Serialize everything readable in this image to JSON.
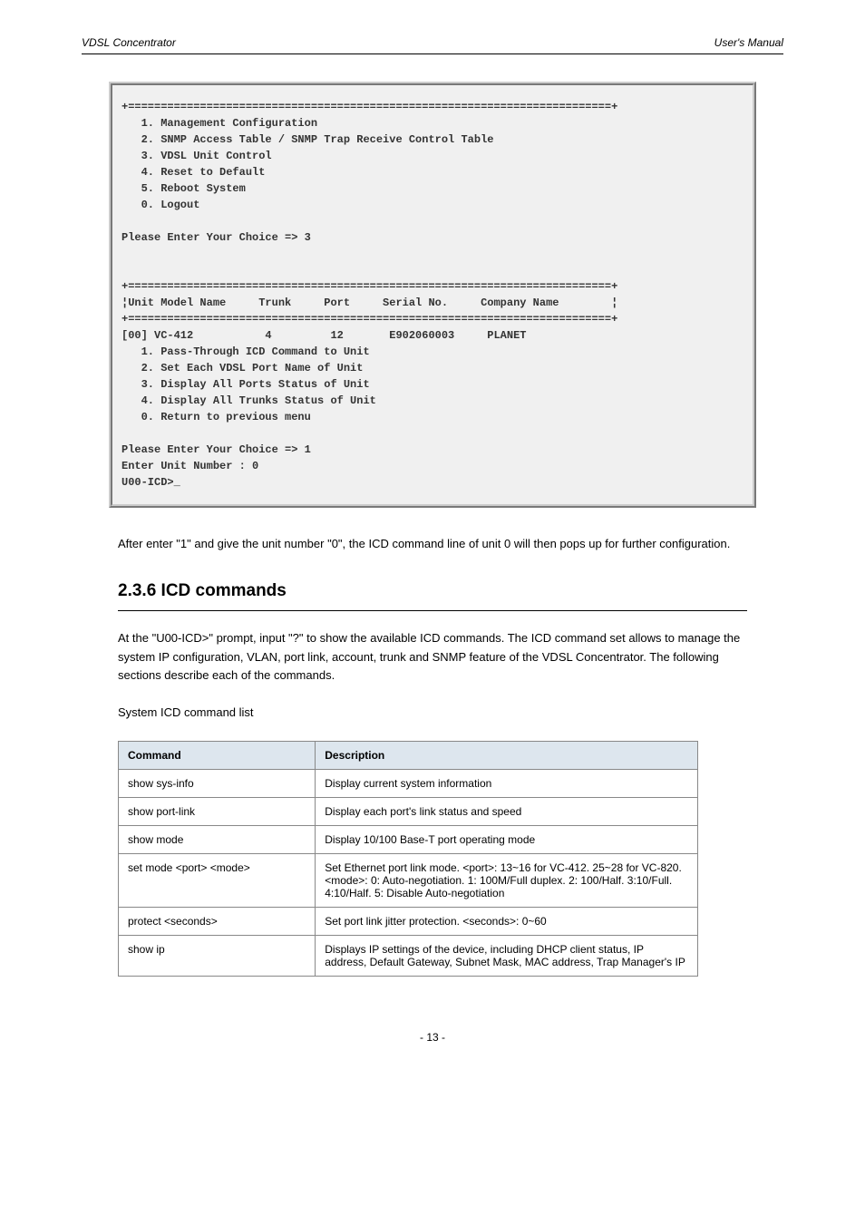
{
  "header": {
    "left": "VDSL Concentrator",
    "right": "User's Manual"
  },
  "terminal": "+==========================================================================+\n   1. Management Configuration\n   2. SNMP Access Table / SNMP Trap Receive Control Table\n   3. VDSL Unit Control\n   4. Reset to Default\n   5. Reboot System\n   0. Logout\n\nPlease Enter Your Choice => 3\n\n\n+==========================================================================+\n¦Unit Model Name     Trunk     Port     Serial No.     Company Name        ¦\n+==========================================================================+\n[00] VC-412           4         12       E902060003     PLANET\n   1. Pass-Through ICD Command to Unit\n   2. Set Each VDSL Port Name of Unit\n   3. Display All Ports Status of Unit\n   4. Display All Trunks Status of Unit\n   0. Return to previous menu\n\nPlease Enter Your Choice => 1\nEnter Unit Number : 0\nU00-ICD>_",
  "paragraphs": {
    "p1": "After enter \"1\" and give the unit number \"0\", the ICD command line of unit 0 will then pops up for further configuration.",
    "heading": "2.3.6 ICD commands",
    "p2": "At the \"U00-ICD>\" prompt, input \"?\" to show the available ICD commands. The ICD command set allows to manage the system IP configuration, VLAN, port link, account, trunk and SNMP feature of the VDSL Concentrator. The following sections describe each of the commands.",
    "listTitle": "System ICD command list"
  },
  "table": {
    "header": {
      "cmd": "Command",
      "desc": "Description"
    },
    "rows": [
      {
        "cmd": "show sys-info",
        "desc": "Display current system information"
      },
      {
        "cmd": "show port-link",
        "desc": "Display each port's link status and speed"
      },
      {
        "cmd": "show mode",
        "desc": "Display 10/100 Base-T port operating mode"
      },
      {
        "cmd": "set mode <port> <mode>",
        "desc": "Set Ethernet port link mode. <port>: 13~16 for VC-412. 25~28 for VC-820. <mode>: 0: Auto-negotiation. 1: 100M/Full duplex. 2: 100/Half. 3:10/Full. 4:10/Half. 5: Disable Auto-negotiation"
      },
      {
        "cmd": "protect <seconds>",
        "desc": "Set port link jitter protection. <seconds>: 0~60"
      },
      {
        "cmd": "show ip",
        "desc": "Displays IP settings of the device, including DHCP client status, IP address, Default Gateway, Subnet Mask, MAC address, Trap Manager's IP"
      }
    ]
  },
  "footer": "- 13 -"
}
